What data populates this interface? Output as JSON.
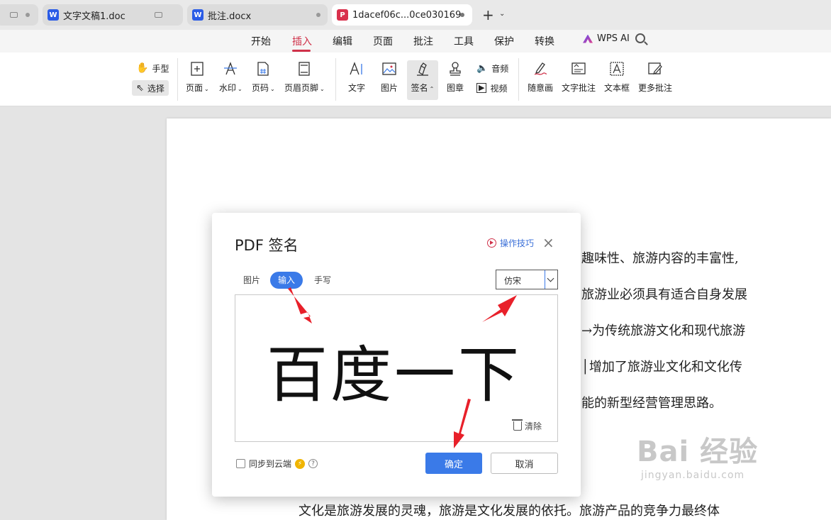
{
  "tabs": [
    {
      "label": "文字文稿1.doc",
      "icon": "word-icon"
    },
    {
      "label": "批注.docx",
      "icon": "word-icon"
    },
    {
      "label": "1dacef06c...0ce030169",
      "icon": "pdf-icon"
    }
  ],
  "menu": [
    "开始",
    "插入",
    "编辑",
    "页面",
    "批注",
    "工具",
    "保护",
    "转换"
  ],
  "menu_active": "插入",
  "wps_ai": "WPS AI",
  "ribbon": {
    "hand": "手型",
    "select": "选择",
    "page": "页面",
    "watermark": "水印",
    "page_num": "页码",
    "header_footer": "页眉页脚",
    "text": "文字",
    "image": "图片",
    "sign": "签名",
    "stamp": "图章",
    "audio": "音频",
    "video": "视频",
    "freehand": "随意画",
    "text_comment": "文字批注",
    "textbox": "文本框",
    "more_comments": "更多批注"
  },
  "document": {
    "lines": [
      "趣味性、旅游内容的丰富性,",
      "旅游业必须具有适合自身发展",
      "→为传统旅游文化和现代旅游",
      "│增加了旅游业文化和文化传",
      "能的新型经营管理思路。",
      "文化是旅游发展的灵魂，旅游是文化发展的依托。旅游产品的竞争力最终体"
    ]
  },
  "dialog": {
    "title": "PDF 签名",
    "tips": "操作技巧",
    "tabs": [
      "图片",
      "输入",
      "手写"
    ],
    "active_tab": "输入",
    "font": "仿宋",
    "signature_text": "百度一下",
    "clear": "清除",
    "sync": "同步到云端",
    "ok": "确定",
    "cancel": "取消"
  },
  "watermark": {
    "main": "Bai 经验",
    "sub": "jingyan.baidu.com"
  },
  "colors": {
    "accent_red": "#d0324a",
    "primary_blue": "#3a7ae8",
    "arrow_red": "#e8202a"
  }
}
